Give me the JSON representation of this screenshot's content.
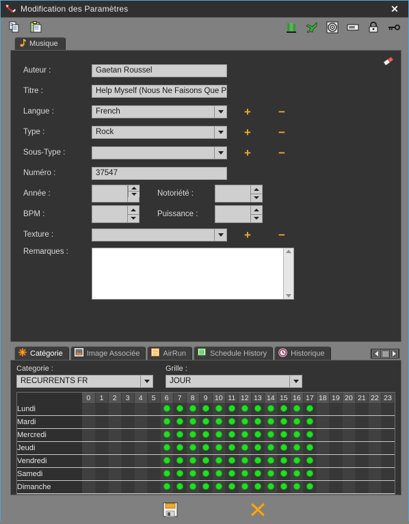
{
  "window": {
    "title": "Modification des Paramètres",
    "close_label": "✕",
    "title_icon": "feather-pen-icon"
  },
  "toolbar": {
    "left": [
      {
        "name": "copy-icon",
        "label": "Copier"
      },
      {
        "name": "paste-icon",
        "label": "Coller"
      }
    ],
    "right": [
      {
        "name": "tower-icon",
        "label": "Tour"
      },
      {
        "name": "airplane-icon",
        "label": "Avion"
      },
      {
        "name": "target-icon",
        "label": "Cible"
      },
      {
        "name": "card-icon",
        "label": "Carte"
      },
      {
        "name": "lock-icon",
        "label": "Verrou"
      },
      {
        "name": "key-icon",
        "label": "Clé"
      }
    ]
  },
  "top_panel": {
    "tab": {
      "label": "Musique",
      "icon": "music-note-icon"
    },
    "eraser_icon": "eraser-icon",
    "fields": {
      "auteur": {
        "label": "Auteur :",
        "value": "Gaetan Roussel"
      },
      "titre": {
        "label": "Titre :",
        "value": "Help Myself (Nous Ne Faisons Que Pas"
      },
      "langue": {
        "label": "Langue :",
        "value": "French"
      },
      "type": {
        "label": "Type :",
        "value": "Rock"
      },
      "sous_type": {
        "label": "Sous-Type :",
        "value": ""
      },
      "numero": {
        "label": "Numéro :",
        "value": "37547"
      },
      "annee": {
        "label": "Année :",
        "value": ""
      },
      "notoriete": {
        "label": "Notoriété :",
        "value": ""
      },
      "bpm": {
        "label": "BPM :",
        "value": ""
      },
      "puissance": {
        "label": "Puissance :",
        "value": ""
      },
      "texture": {
        "label": "Texture :",
        "value": ""
      },
      "remarques": {
        "label": "Remarques :",
        "value": ""
      }
    },
    "add_label": "+",
    "remove_label": "−"
  },
  "bottom_panel": {
    "tabs": [
      {
        "label": "Catégorie",
        "icon": "asterisk-icon",
        "active": true
      },
      {
        "label": "Image Associée",
        "icon": "image-icon",
        "active": false
      },
      {
        "label": "AirRun",
        "icon": "list-orange-icon",
        "active": false
      },
      {
        "label": "Schedule History",
        "icon": "list-green-icon",
        "active": false
      },
      {
        "label": "Historique",
        "icon": "clock-icon",
        "active": false
      }
    ],
    "tab_nav": {
      "prev": "◀",
      "menu": "≡",
      "next": "▶"
    },
    "categorie": {
      "label": "Categorie :",
      "value": "RECURRENTS FR"
    },
    "grille": {
      "label": "Grille :",
      "value": "JOUR"
    },
    "schedule": {
      "hours": [
        "0",
        "1",
        "2",
        "3",
        "4",
        "5",
        "6",
        "7",
        "8",
        "9",
        "10",
        "11",
        "12",
        "13",
        "14",
        "15",
        "16",
        "17",
        "18",
        "19",
        "20",
        "21",
        "22",
        "23"
      ],
      "days": [
        "Lundi",
        "Mardi",
        "Mercredi",
        "Jeudi",
        "Vendredi",
        "Samedi",
        "Dimanche"
      ],
      "active_hours": {
        "Lundi": [
          6,
          7,
          8,
          9,
          10,
          11,
          12,
          13,
          14,
          15,
          16,
          17
        ],
        "Mardi": [
          6,
          7,
          8,
          9,
          10,
          11,
          12,
          13,
          14,
          15,
          16,
          17
        ],
        "Mercredi": [
          6,
          7,
          8,
          9,
          10,
          11,
          12,
          13,
          14,
          15,
          16,
          17
        ],
        "Jeudi": [
          6,
          7,
          8,
          9,
          10,
          11,
          12,
          13,
          14,
          15,
          16,
          17
        ],
        "Vendredi": [
          6,
          7,
          8,
          9,
          10,
          11,
          12,
          13,
          14,
          15,
          16,
          17
        ],
        "Samedi": [
          6,
          7,
          8,
          9,
          10,
          11,
          12,
          13,
          14,
          15,
          16,
          17
        ],
        "Dimanche": [
          6,
          7,
          8,
          9,
          10,
          11,
          12,
          13,
          14,
          15,
          16,
          17
        ]
      },
      "dot_color": "#20e020"
    }
  },
  "actions": {
    "save": {
      "name": "save-button",
      "icon": "floppy-disk-icon",
      "label": "Enregistrer"
    },
    "cancel": {
      "name": "cancel-button",
      "icon": "x-cross-icon",
      "label": "Annuler"
    }
  },
  "colors": {
    "accent_orange": "#f0a830",
    "panel_bg": "#333333",
    "window_bg": "#808080",
    "titlebar_bg": "#303030",
    "border_blue": "#4aa8d8"
  }
}
